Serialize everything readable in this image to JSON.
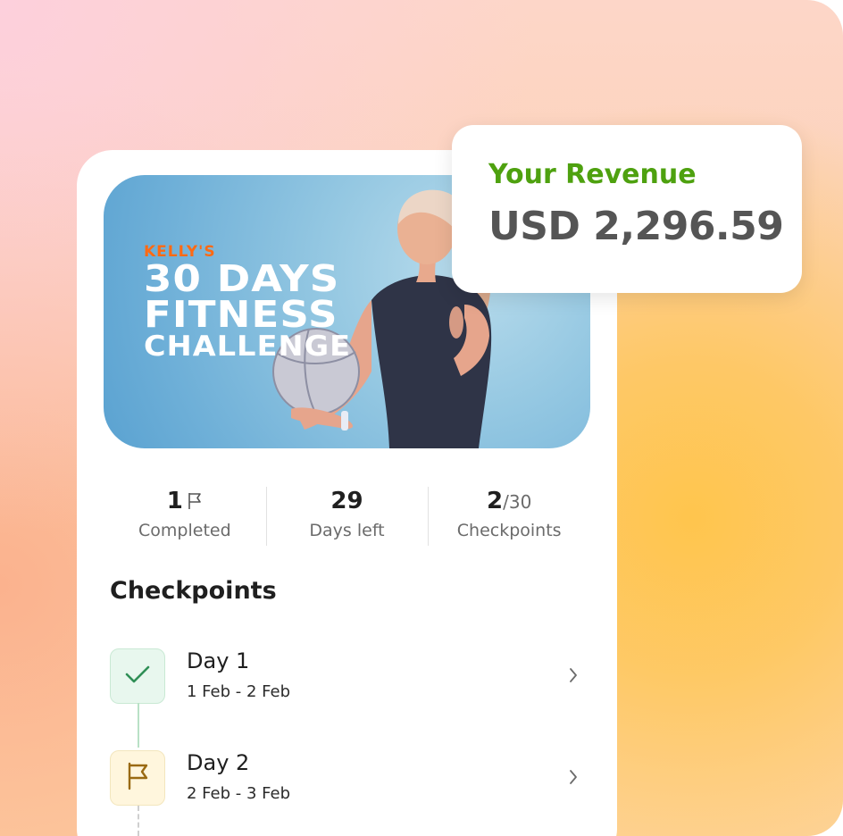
{
  "hero": {
    "kelly": "KELLY'S",
    "line1": "30 DAYS",
    "line2": "FITNESS",
    "line3": "CHALLENGE"
  },
  "stats": [
    {
      "value": "1",
      "label": "Completed",
      "icon": "flag-icon"
    },
    {
      "value": "29",
      "label": "Days left"
    },
    {
      "value": "2",
      "sub": "/30",
      "label": "Checkpoints"
    }
  ],
  "checkpoints": {
    "title": "Checkpoints",
    "items": [
      {
        "name": "Day 1",
        "dates": "1 Feb - 2 Feb",
        "status": "completed",
        "icon": "check-icon"
      },
      {
        "name": "Day 2",
        "dates": "2 Feb - 3 Feb",
        "status": "current",
        "icon": "flag-icon"
      }
    ]
  },
  "revenue": {
    "label": "Your Revenue",
    "value": "USD 2,296.59"
  },
  "colors": {
    "accent_green": "#4ea10f",
    "brand_orange": "#ff6a13",
    "check_green": "#2f8f56",
    "flag_brown": "#9a6a12"
  }
}
